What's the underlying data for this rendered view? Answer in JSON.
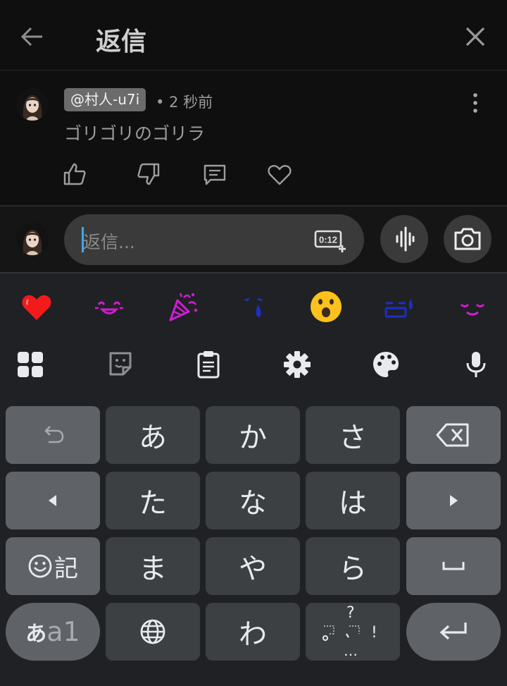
{
  "header": {
    "title": "返信",
    "back_icon": "arrow-left-icon",
    "close_icon": "close-icon"
  },
  "comment": {
    "author": "@村人-u7i",
    "time": "• 2 秒前",
    "text": "ゴリゴリのゴリラ",
    "actions": [
      "thumbs-up-icon",
      "thumbs-down-icon",
      "reply-icon",
      "heart-icon"
    ]
  },
  "reply": {
    "placeholder": "返信...",
    "clip_label": "0:12",
    "voice_icon": "voice-wave-icon",
    "camera_icon": "camera-icon"
  },
  "keyboard": {
    "emoji_row": [
      "red-heart",
      "smiling-face-magenta",
      "party-popper",
      "tear-face-blue",
      "astonished-face",
      "crying-face-blue",
      "relieved-face-magenta"
    ],
    "toolbar": [
      "apps-grid-icon",
      "sticker-icon",
      "clipboard-icon",
      "settings-gear-icon",
      "palette-icon",
      "microphone-icon"
    ],
    "rows": [
      [
        "↩",
        "あ",
        "か",
        "さ",
        "⌫"
      ],
      [
        "◀",
        "た",
        "な",
        "は",
        "▶"
      ],
      [
        "☺記",
        "ま",
        "や",
        "ら",
        "␣"
      ],
      [
        "あa1",
        "🌐",
        "わ",
        "゛゜小 ?!…",
        "↵"
      ]
    ],
    "keys": {
      "a": "あ",
      "ka": "か",
      "sa": "さ",
      "ta": "た",
      "na": "な",
      "ha": "は",
      "ma": "ま",
      "ya": "や",
      "ra": "ら",
      "wa": "わ",
      "kigou": "記",
      "mode_a": "あ",
      "mode_rest": "a1",
      "punct_q": "?",
      "punct_ex": "!",
      "punct_dots": "…"
    },
    "colors": {
      "key": "#3c4043",
      "key_dark": "#5f6368",
      "background": "#202124",
      "accent": "#3ea6ff"
    }
  }
}
